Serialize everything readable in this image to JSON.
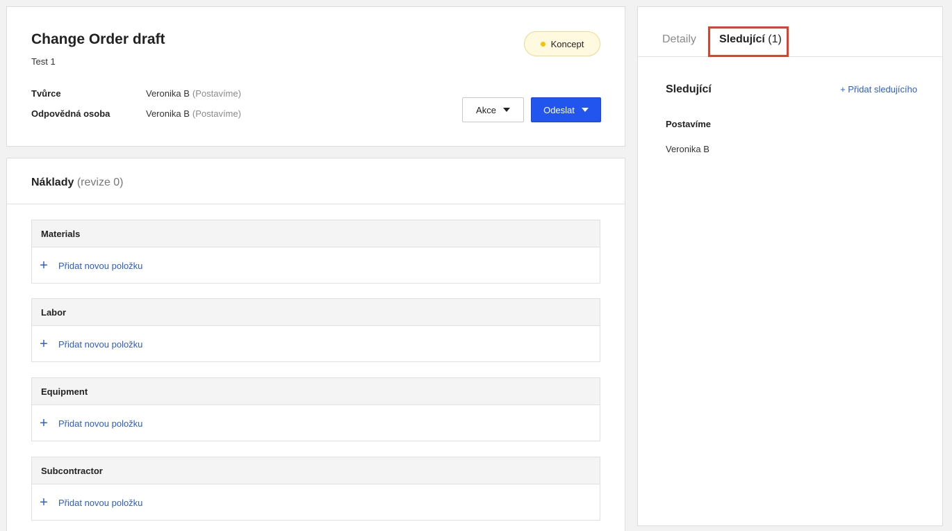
{
  "header": {
    "title": "Change Order draft",
    "subtitle": "Test 1",
    "status": "Koncept",
    "meta": [
      {
        "label": "Tvůrce",
        "name": "Veronika B",
        "org": "(Postavíme)"
      },
      {
        "label": "Odpovědná osoba",
        "name": "Veronika B",
        "org": "(Postavíme)"
      }
    ],
    "actions_label": "Akce",
    "send_label": "Odeslat"
  },
  "costs": {
    "title": "Náklady",
    "revision": "(revize 0)",
    "sections": [
      {
        "name": "Materials",
        "add_label": "Přidat novou položku"
      },
      {
        "name": "Labor",
        "add_label": "Přidat novou položku"
      },
      {
        "name": "Equipment",
        "add_label": "Přidat novou položku"
      },
      {
        "name": "Subcontractor",
        "add_label": "Přidat novou položku"
      }
    ]
  },
  "panel": {
    "tabs": {
      "detail": "Detaily",
      "followers": "Sledující",
      "followers_count": "(1)"
    },
    "followers_title": "Sledující",
    "add_follower": "+ Přidat sledujícího",
    "group": "Postavíme",
    "follower": "Veronika B"
  },
  "colors": {
    "primary": "#2255ee",
    "link": "#2b5bd8",
    "status_dot": "#f5c400",
    "highlight": "#e0402a"
  }
}
